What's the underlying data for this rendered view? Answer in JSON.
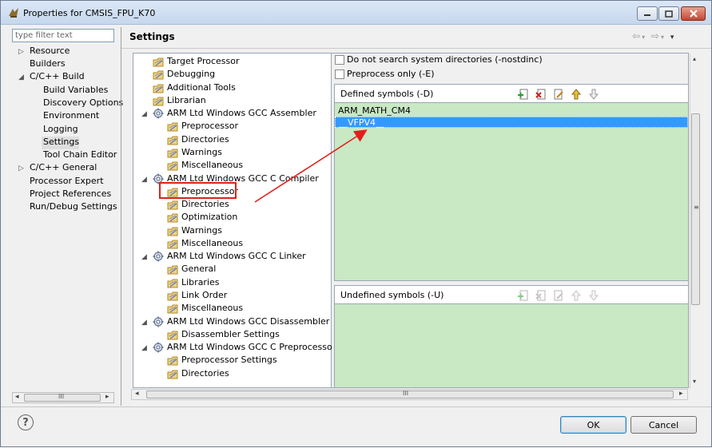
{
  "window": {
    "title": "Properties for CMSIS_FPU_K70"
  },
  "left_nav": {
    "filter_placeholder": "type filter text",
    "items": [
      {
        "label": "Resource"
      },
      {
        "label": "Builders"
      },
      {
        "label": "C/C++ Build"
      },
      {
        "label": "Build Variables"
      },
      {
        "label": "Discovery Options"
      },
      {
        "label": "Environment"
      },
      {
        "label": "Logging"
      },
      {
        "label": "Settings"
      },
      {
        "label": "Tool Chain Editor"
      },
      {
        "label": "C/C++ General"
      },
      {
        "label": "Processor Expert"
      },
      {
        "label": "Project References"
      },
      {
        "label": "Run/Debug Settings"
      }
    ],
    "scroll_thumb_label": "III"
  },
  "page": {
    "title": "Settings"
  },
  "tool_tree": {
    "items": [
      {
        "label": "Target Processor"
      },
      {
        "label": "Debugging"
      },
      {
        "label": "Additional Tools"
      },
      {
        "label": "Librarian"
      },
      {
        "label": "ARM Ltd Windows GCC Assembler"
      },
      {
        "label": "Preprocessor"
      },
      {
        "label": "Directories"
      },
      {
        "label": "Warnings"
      },
      {
        "label": "Miscellaneous"
      },
      {
        "label": "ARM Ltd Windows GCC C Compiler"
      },
      {
        "label": "Preprocessor"
      },
      {
        "label": "Directories"
      },
      {
        "label": "Optimization"
      },
      {
        "label": "Warnings"
      },
      {
        "label": "Miscellaneous"
      },
      {
        "label": "ARM Ltd Windows GCC C Linker"
      },
      {
        "label": "General"
      },
      {
        "label": "Libraries"
      },
      {
        "label": "Link Order"
      },
      {
        "label": "Miscellaneous"
      },
      {
        "label": "ARM Ltd Windows GCC Disassembler"
      },
      {
        "label": "Disassembler Settings"
      },
      {
        "label": "ARM Ltd Windows GCC C Preprocessor"
      },
      {
        "label": "Preprocessor Settings"
      },
      {
        "label": "Directories"
      }
    ]
  },
  "options": {
    "nostdinc_label": "Do not search system directories (-nostdinc)",
    "preprocess_only_label": "Preprocess only (-E)",
    "defined_symbols": {
      "title": "Defined symbols (-D)",
      "values": [
        "ARM_MATH_CM4",
        "__VFPV4__"
      ]
    },
    "undefined_symbols": {
      "title": "Undefined symbols (-U)",
      "values": []
    },
    "hscroll_label": "III"
  },
  "buttons": {
    "ok": "OK",
    "cancel": "Cancel",
    "help": "?"
  },
  "colors": {
    "list_background": "#c9e8c4",
    "selection": "#3399ff",
    "annotation": "#e0201c"
  }
}
